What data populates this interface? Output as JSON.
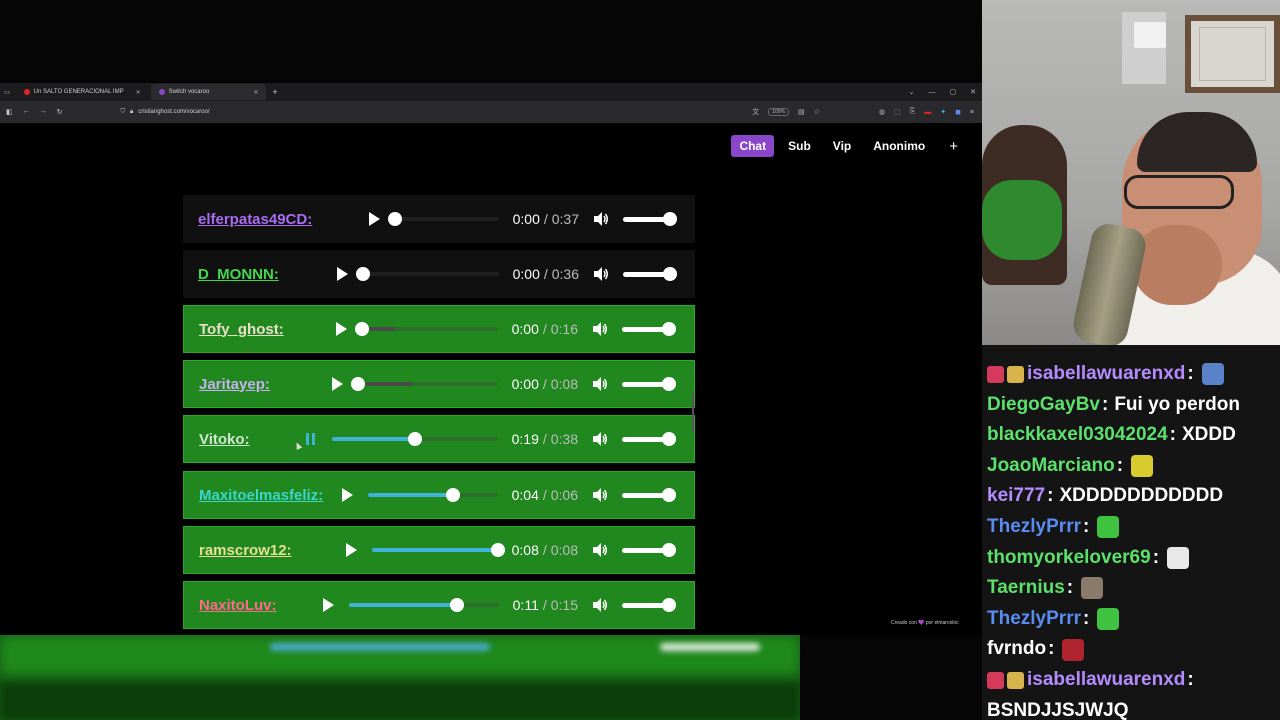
{
  "browser": {
    "tabs": [
      {
        "label": "Un SALTO GENERACIONAL IMP",
        "active": false,
        "color": "#e02424"
      },
      {
        "label": "Switch vocaroo",
        "active": true,
        "color": "#8a46c9"
      }
    ],
    "new_tab": "+",
    "url": "cristianghost.com/vocaroo/",
    "zoom": "100%"
  },
  "page": {
    "pills": [
      {
        "label": "Chat",
        "active": true
      },
      {
        "label": "Sub",
        "active": false
      },
      {
        "label": "Vip",
        "active": false
      },
      {
        "label": "Anonimo",
        "active": false
      },
      {
        "label": "+",
        "active": false
      }
    ],
    "rows": [
      {
        "user": "elferpatas49CD:",
        "color": "#a86cf0",
        "bg": "gray",
        "current": "0:00",
        "duration": "0:37",
        "progress": 0.0,
        "playing": false
      },
      {
        "user": "D_MONNN:",
        "color": "#42d84b",
        "bg": "gray",
        "current": "0:00",
        "duration": "0:36",
        "progress": 0.0,
        "playing": false
      },
      {
        "user": "Tofy_ghost:",
        "color": "#e8e0c8",
        "bg": "green",
        "current": "0:00",
        "duration": "0:16",
        "progress": 0.0,
        "buffered": 0.1,
        "playing": false
      },
      {
        "user": "Jaritayep:",
        "color": "#c8b0f0",
        "bg": "green",
        "current": "0:00",
        "duration": "0:08",
        "progress": 0.0,
        "buffered": 0.25,
        "playing": false
      },
      {
        "user": "Vitoko:",
        "color": "#cfe6d0",
        "bg": "green",
        "current": "0:19",
        "duration": "0:38",
        "progress": 0.5,
        "playing": true
      },
      {
        "user": "Maxitoelmasfeliz:",
        "color": "#3ad6c8",
        "bg": "green",
        "current": "0:04",
        "duration": "0:06",
        "progress": 0.66,
        "playing": false
      },
      {
        "user": "ramscrow12:",
        "color": "#e6e090",
        "bg": "green",
        "current": "0:08",
        "duration": "0:08",
        "progress": 1.0,
        "playing": false
      },
      {
        "user": "NaxitoLuv:",
        "color": "#ff6a8a",
        "bg": "green",
        "current": "0:11",
        "duration": "0:15",
        "progress": 0.72,
        "playing": false
      }
    ],
    "time_sep": "/",
    "credit": "Creado con 💜 por elmarceloc"
  },
  "chat": {
    "messages": [
      {
        "user": "isabellawuarenxd",
        "color": "#b58cff",
        "text": "",
        "emote": "#5a82c8",
        "badges": [
          "#d63a5a",
          "#d8b24a"
        ]
      },
      {
        "user": "DiegoGayBv",
        "color": "#5ce06b",
        "text": "Fui yo perdon",
        "badges": []
      },
      {
        "user": "blackkaxel03042024",
        "color": "#5ce06b",
        "text": "XDDD",
        "badges": []
      },
      {
        "user": "JoaoMarciano",
        "color": "#5ce06b",
        "text": "",
        "emote": "#d8cc30",
        "badges": []
      },
      {
        "user": "kei777",
        "color": "#b58cff",
        "text": "XDDDDDDDDDDD",
        "badges": []
      },
      {
        "user": "ThezlyPrrr",
        "color": "#5a8cf0",
        "text": "",
        "emote": "#3fc23f",
        "badges": []
      },
      {
        "user": "thomyorkelover69",
        "color": "#5ce06b",
        "text": "",
        "emote": "#e8e8e8",
        "badges": []
      },
      {
        "user": "Taernius",
        "color": "#5ce06b",
        "text": "",
        "emote": "#8a7a6a",
        "badges": []
      },
      {
        "user": "ThezlyPrrr",
        "color": "#5a8cf0",
        "text": "",
        "emote": "#3fc23f",
        "badges": []
      },
      {
        "user": "fvrndo",
        "color": "#ffffff",
        "text": "",
        "emote": "#b0242f",
        "badges": []
      },
      {
        "user": "isabellawuarenxd",
        "color": "#b58cff",
        "text": "",
        "badges": [
          "#d63a5a",
          "#d8b24a"
        ]
      }
    ],
    "continuation": "BSNDJJSJWJQ"
  },
  "colors": {
    "accent": "#8a46c9",
    "row_green": "#21871f",
    "seek_fill": "#3fb3d8"
  }
}
